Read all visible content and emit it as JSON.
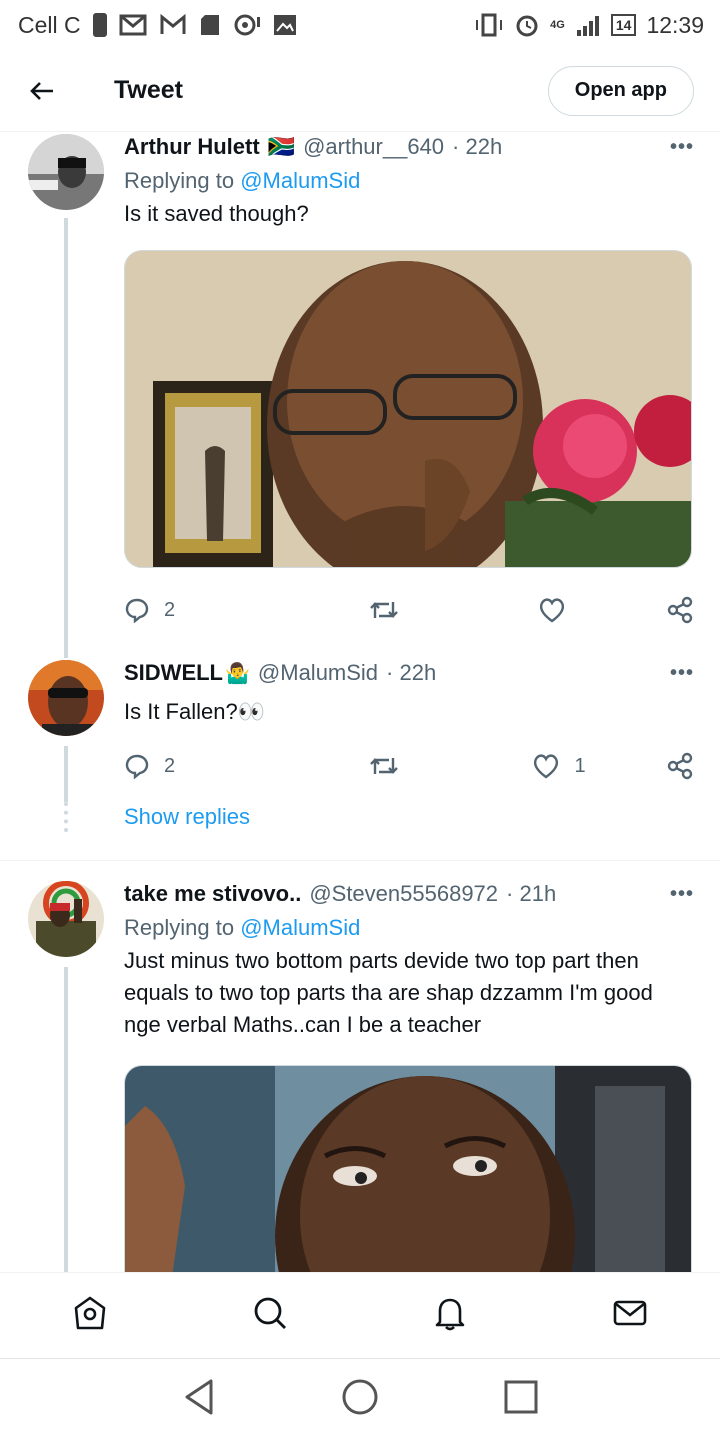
{
  "status_bar": {
    "carrier": "Cell C",
    "network": "4G",
    "battery": "14",
    "time": "12:39"
  },
  "header": {
    "title": "Tweet",
    "open_app_label": "Open app"
  },
  "tweets": [
    {
      "name": "Arthur Hulett",
      "flag": "🇿🇦",
      "handle": "@arthur__640",
      "time": "· 22h",
      "replying_prefix": "Replying to",
      "replying_to": "@MalumSid",
      "text": "Is it saved though?",
      "replies": "2",
      "likes": ""
    },
    {
      "name": "SIDWELL",
      "emoji": "🤷‍♂️",
      "handle": "@MalumSid",
      "time": "· 22h",
      "text": "Is It Fallen?👀",
      "replies": "2",
      "likes": "1",
      "show_replies": "Show replies"
    },
    {
      "name": "take me stivovo..",
      "handle": "@Steven55568972",
      "time": "· 21h",
      "replying_prefix": "Replying to",
      "replying_to": "@MalumSid",
      "text": "Just minus two bottom parts devide two top part then equals to two top parts tha are shap dzzamm I'm good nge verbal Maths..can I be a teacher"
    }
  ],
  "more_glyph": "•••",
  "colors": {
    "link": "#1d9bf0",
    "secondary_text": "#536471",
    "thread_line": "#cfd9de"
  }
}
